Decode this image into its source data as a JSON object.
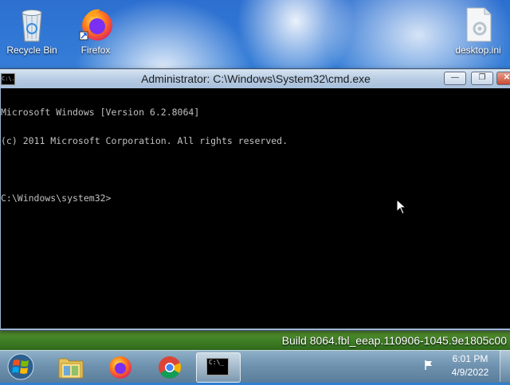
{
  "desktop": {
    "icons": [
      {
        "label": "Recycle Bin",
        "icon": "recycle-bin-icon"
      },
      {
        "label": "Firefox",
        "icon": "firefox-icon"
      },
      {
        "label": "desktop.ini",
        "icon": "settings-file-icon"
      }
    ],
    "build_text": "Build 8064.fbl_eeap.110906-1045.9e1805c00"
  },
  "window": {
    "title": "Administrator: C:\\Windows\\System32\\cmd.exe",
    "icon_text": "C:\\.",
    "console_lines": [
      "Microsoft Windows [Version 6.2.8064]",
      "(c) 2011 Microsoft Corporation. All rights reserved.",
      "",
      "C:\\Windows\\system32>"
    ]
  },
  "taskbar": {
    "apps": [
      {
        "name": "File Explorer",
        "icon": "folder-icon"
      },
      {
        "name": "Firefox",
        "icon": "firefox-icon"
      },
      {
        "name": "Chrome",
        "icon": "chrome-icon"
      },
      {
        "name": "Command Prompt",
        "icon": "cmd-icon",
        "active": true
      }
    ],
    "cmd_icon_text": "C:\\_",
    "clock": {
      "time": "6:01 PM",
      "date": "4/9/2022"
    }
  },
  "colors": {
    "console_bg": "#000000",
    "console_fg": "#c0c0c0",
    "close_button": "#c94a33"
  }
}
